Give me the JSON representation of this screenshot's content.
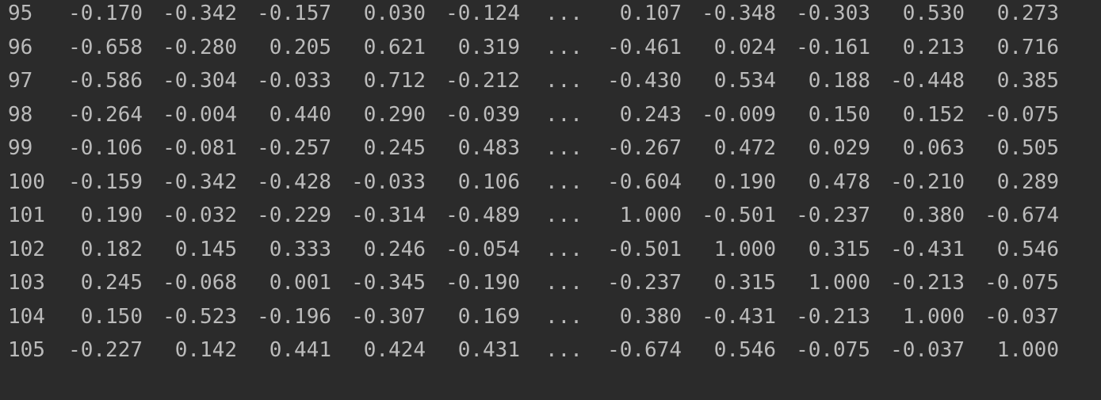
{
  "console": {
    "ellipsis": "...",
    "rows": [
      {
        "index": "95",
        "values": [
          "-0.170",
          "-0.342",
          "-0.157",
          "0.030",
          "-0.124",
          "0.107",
          "-0.348",
          "-0.303",
          "0.530",
          "0.273"
        ]
      },
      {
        "index": "96",
        "values": [
          "-0.658",
          "-0.280",
          "0.205",
          "0.621",
          "0.319",
          "-0.461",
          "0.024",
          "-0.161",
          "0.213",
          "0.716"
        ]
      },
      {
        "index": "97",
        "values": [
          "-0.586",
          "-0.304",
          "-0.033",
          "0.712",
          "-0.212",
          "-0.430",
          "0.534",
          "0.188",
          "-0.448",
          "0.385"
        ]
      },
      {
        "index": "98",
        "values": [
          "-0.264",
          "-0.004",
          "0.440",
          "0.290",
          "-0.039",
          "0.243",
          "-0.009",
          "0.150",
          "0.152",
          "-0.075"
        ]
      },
      {
        "index": "99",
        "values": [
          "-0.106",
          "-0.081",
          "-0.257",
          "0.245",
          "0.483",
          "-0.267",
          "0.472",
          "0.029",
          "0.063",
          "0.505"
        ]
      },
      {
        "index": "100",
        "values": [
          "-0.159",
          "-0.342",
          "-0.428",
          "-0.033",
          "0.106",
          "-0.604",
          "0.190",
          "0.478",
          "-0.210",
          "0.289"
        ]
      },
      {
        "index": "101",
        "values": [
          "0.190",
          "-0.032",
          "-0.229",
          "-0.314",
          "-0.489",
          "1.000",
          "-0.501",
          "-0.237",
          "0.380",
          "-0.674"
        ]
      },
      {
        "index": "102",
        "values": [
          "0.182",
          "0.145",
          "0.333",
          "0.246",
          "-0.054",
          "-0.501",
          "1.000",
          "0.315",
          "-0.431",
          "0.546"
        ]
      },
      {
        "index": "103",
        "values": [
          "0.245",
          "-0.068",
          "0.001",
          "-0.345",
          "-0.190",
          "-0.237",
          "0.315",
          "1.000",
          "-0.213",
          "-0.075"
        ]
      },
      {
        "index": "104",
        "values": [
          "0.150",
          "-0.523",
          "-0.196",
          "-0.307",
          "0.169",
          "0.380",
          "-0.431",
          "-0.213",
          "1.000",
          "-0.037"
        ]
      },
      {
        "index": "105",
        "values": [
          "-0.227",
          "0.142",
          "0.441",
          "0.424",
          "0.431",
          "-0.674",
          "0.546",
          "-0.075",
          "-0.037",
          "1.000"
        ]
      }
    ]
  }
}
